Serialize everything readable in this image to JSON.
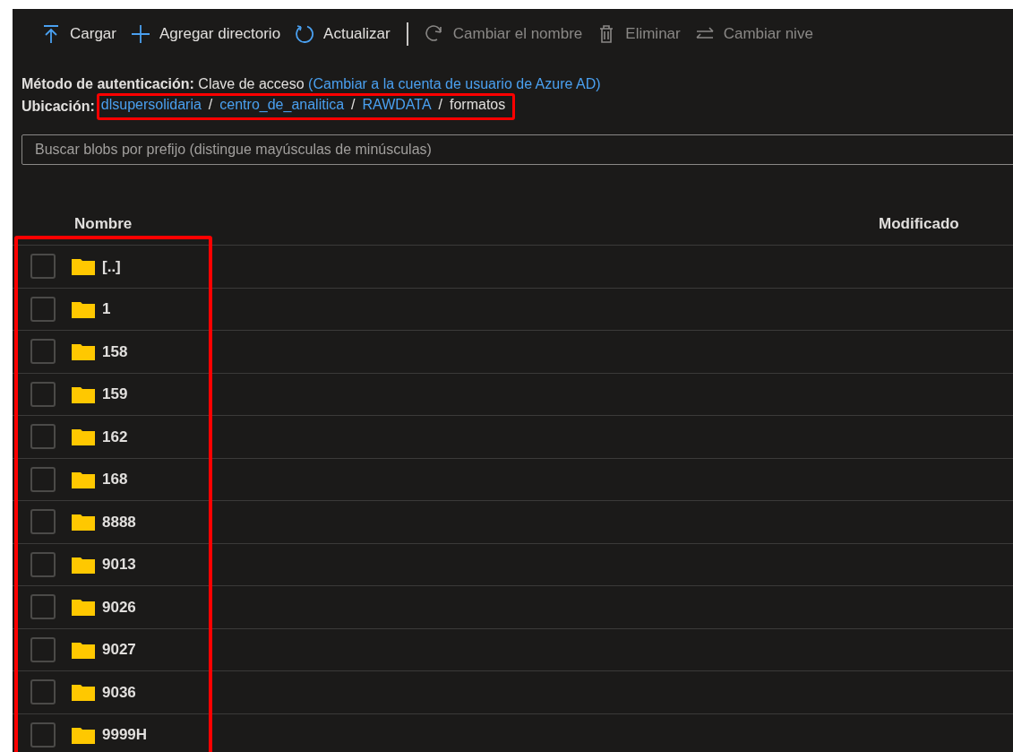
{
  "toolbar": [
    {
      "kind": "upload",
      "label": "Cargar",
      "disabled": false
    },
    {
      "kind": "add",
      "label": "Agregar directorio",
      "disabled": false
    },
    {
      "kind": "refresh",
      "label": "Actualizar",
      "disabled": false
    },
    {
      "kind": "separator"
    },
    {
      "kind": "rename",
      "label": "Cambiar el nombre",
      "disabled": true
    },
    {
      "kind": "delete",
      "label": "Eliminar",
      "disabled": true
    },
    {
      "kind": "tier",
      "label": "Cambiar nive",
      "disabled": true
    }
  ],
  "auth": {
    "label": "Método de autenticación:",
    "value": "Clave de acceso",
    "link": "(Cambiar a la cuenta de usuario de Azure AD)"
  },
  "location": {
    "label": "Ubicación:",
    "highlighted": true,
    "crumbs": [
      {
        "kind": "link",
        "text": "dlsupersolidaria"
      },
      {
        "kind": "separator",
        "text": "/"
      },
      {
        "kind": "link",
        "text": "centro_de_analitica"
      },
      {
        "kind": "separator",
        "text": "/"
      },
      {
        "kind": "link",
        "text": "RAWDATA"
      },
      {
        "kind": "separator",
        "text": "/"
      },
      {
        "kind": "current",
        "text": "formatos"
      }
    ]
  },
  "search": {
    "placeholder": "Buscar blobs por prefijo (distingue mayúsculas de minúsculas)"
  },
  "table": {
    "columns": [
      "Nombre",
      "Modificado"
    ],
    "rows_highlighted": true,
    "rows": [
      {
        "name": "[..]",
        "checked": false
      },
      {
        "name": "1",
        "checked": false
      },
      {
        "name": "158",
        "checked": false
      },
      {
        "name": "159",
        "checked": false
      },
      {
        "name": "162",
        "checked": false
      },
      {
        "name": "168",
        "checked": false
      },
      {
        "name": "8888",
        "checked": false
      },
      {
        "name": "9013",
        "checked": false
      },
      {
        "name": "9026",
        "checked": false
      },
      {
        "name": "9027",
        "checked": false
      },
      {
        "name": "9036",
        "checked": false
      },
      {
        "name": "9999H",
        "checked": false
      }
    ]
  }
}
